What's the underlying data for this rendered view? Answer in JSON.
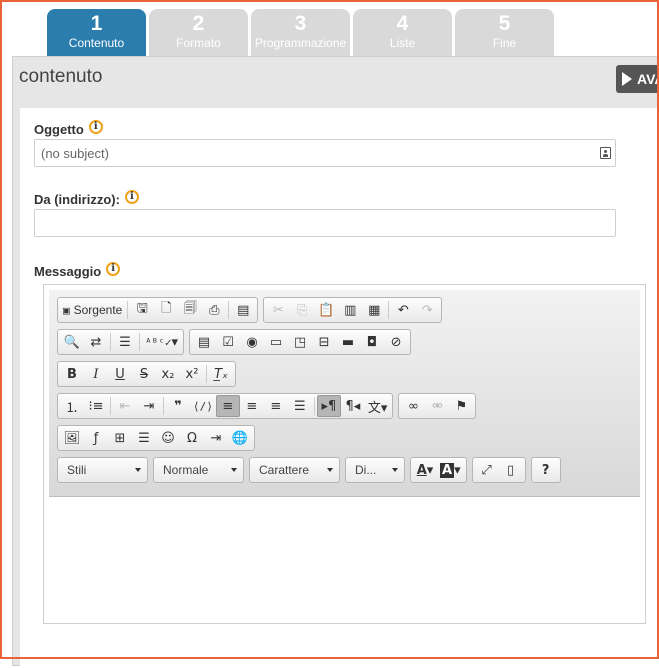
{
  "steps": [
    {
      "num": "1",
      "label": "Contenuto",
      "active": true
    },
    {
      "num": "2",
      "label": "Formato",
      "active": false
    },
    {
      "num": "3",
      "label": "Programmazione",
      "active": false
    },
    {
      "num": "4",
      "label": "Liste",
      "active": false
    },
    {
      "num": "5",
      "label": "Fine",
      "active": false
    }
  ],
  "panel": {
    "title": "contenuto",
    "next_label": "AVA"
  },
  "fields": {
    "subject": {
      "label": "Oggetto",
      "value": "(no subject)"
    },
    "from": {
      "label": "Da (indirizzo):",
      "value": ""
    },
    "message": {
      "label": "Messaggio"
    }
  },
  "toolbar": {
    "source_label": "Sorgente",
    "info_glyph": "i",
    "combos": {
      "styles": "Stili",
      "format": "Normale",
      "font": "Carattere",
      "size": "Di..."
    },
    "help": "?"
  },
  "colors": {
    "active_step": "#2b7dae",
    "inactive_step": "#d9d9d9",
    "info_ring": "#f0a21b",
    "frame": "#e8623a"
  }
}
